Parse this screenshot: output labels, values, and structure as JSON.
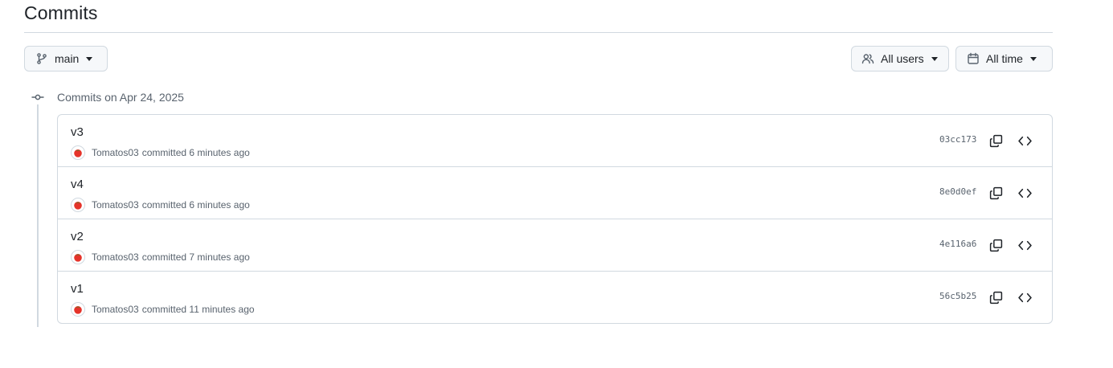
{
  "page": {
    "title": "Commits"
  },
  "filters": {
    "branch_label": "main",
    "users_label": "All users",
    "time_label": "All time"
  },
  "group": {
    "heading": "Commits on Apr 24, 2025"
  },
  "commits": [
    {
      "message": "v3",
      "author": "Tomatos03",
      "action": "committed",
      "time": "6 minutes ago",
      "sha": "03cc173"
    },
    {
      "message": "v4",
      "author": "Tomatos03",
      "action": "committed",
      "time": "6 minutes ago",
      "sha": "8e0d0ef"
    },
    {
      "message": "v2",
      "author": "Tomatos03",
      "action": "committed",
      "time": "7 minutes ago",
      "sha": "4e116a6"
    },
    {
      "message": "v1",
      "author": "Tomatos03",
      "action": "committed",
      "time": "11 minutes ago",
      "sha": "56c5b25"
    }
  ],
  "icons": {
    "branch": "git-branch-icon",
    "users": "people-icon",
    "time": "calendar-icon",
    "caret": "triangle-down-icon",
    "commit": "git-commit-icon",
    "avatar": "tomato-avatar",
    "copy": "copy-icon",
    "browse": "code-icon"
  },
  "colors": {
    "border": "#d1d9e0",
    "muted_text": "#59636e",
    "button_bg": "#f6f8fa",
    "tomato": "#e5332a"
  }
}
